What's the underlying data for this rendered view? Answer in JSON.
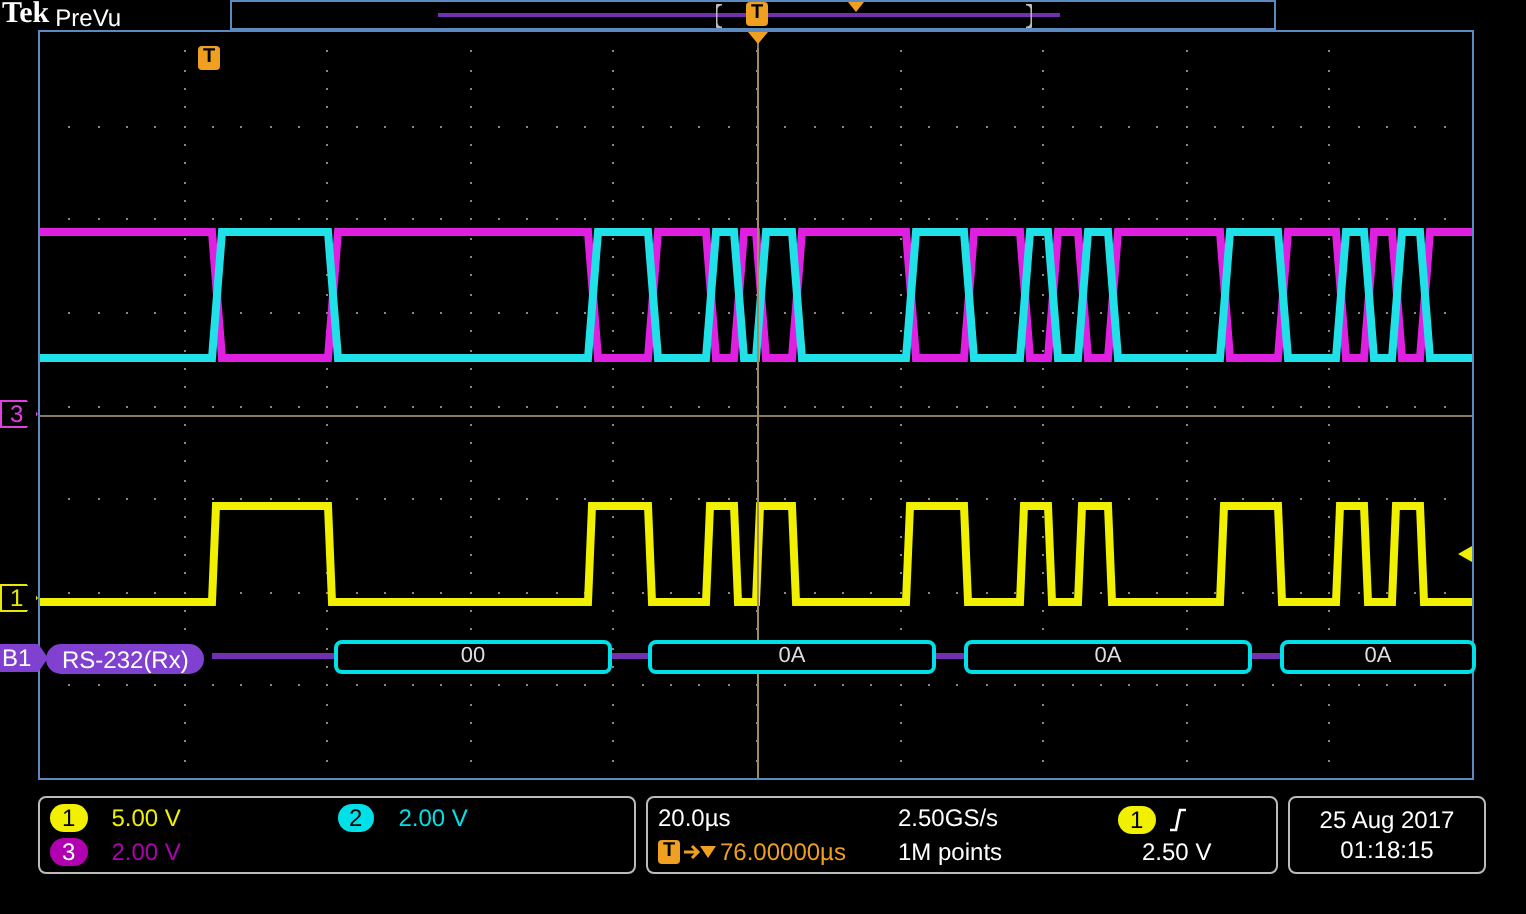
{
  "brand": {
    "logo": "Tek",
    "mode": "PreVu"
  },
  "overview": {
    "trigger_badge": "T"
  },
  "graticule": {
    "trigger_badge": "T"
  },
  "trace_markers": [
    {
      "label": "3",
      "color": "#e040e0"
    },
    {
      "label": "1",
      "color": "#e8e800"
    }
  ],
  "bus": {
    "label": "B1",
    "protocol": "RS-232(Rx)",
    "packets": [
      "00",
      "0A",
      "0A",
      "0A"
    ]
  },
  "channels": [
    {
      "badge": "1",
      "scale": "5.00 V",
      "color": "#f0f000"
    },
    {
      "badge": "2",
      "scale": "2.00 V",
      "color": "#00e0e8"
    },
    {
      "badge": "3",
      "scale": "2.00 V",
      "color": "#b000b0"
    }
  ],
  "timebase": {
    "scale": "20.0µs",
    "sample_rate": "2.50GS/s",
    "trigger_badge": "T",
    "trigger_position": "76.00000µs",
    "record_length": "1M points"
  },
  "trigger": {
    "source": "1",
    "level": "2.50 V"
  },
  "datetime": {
    "date": "25 Aug 2017",
    "time": "01:18:15"
  }
}
